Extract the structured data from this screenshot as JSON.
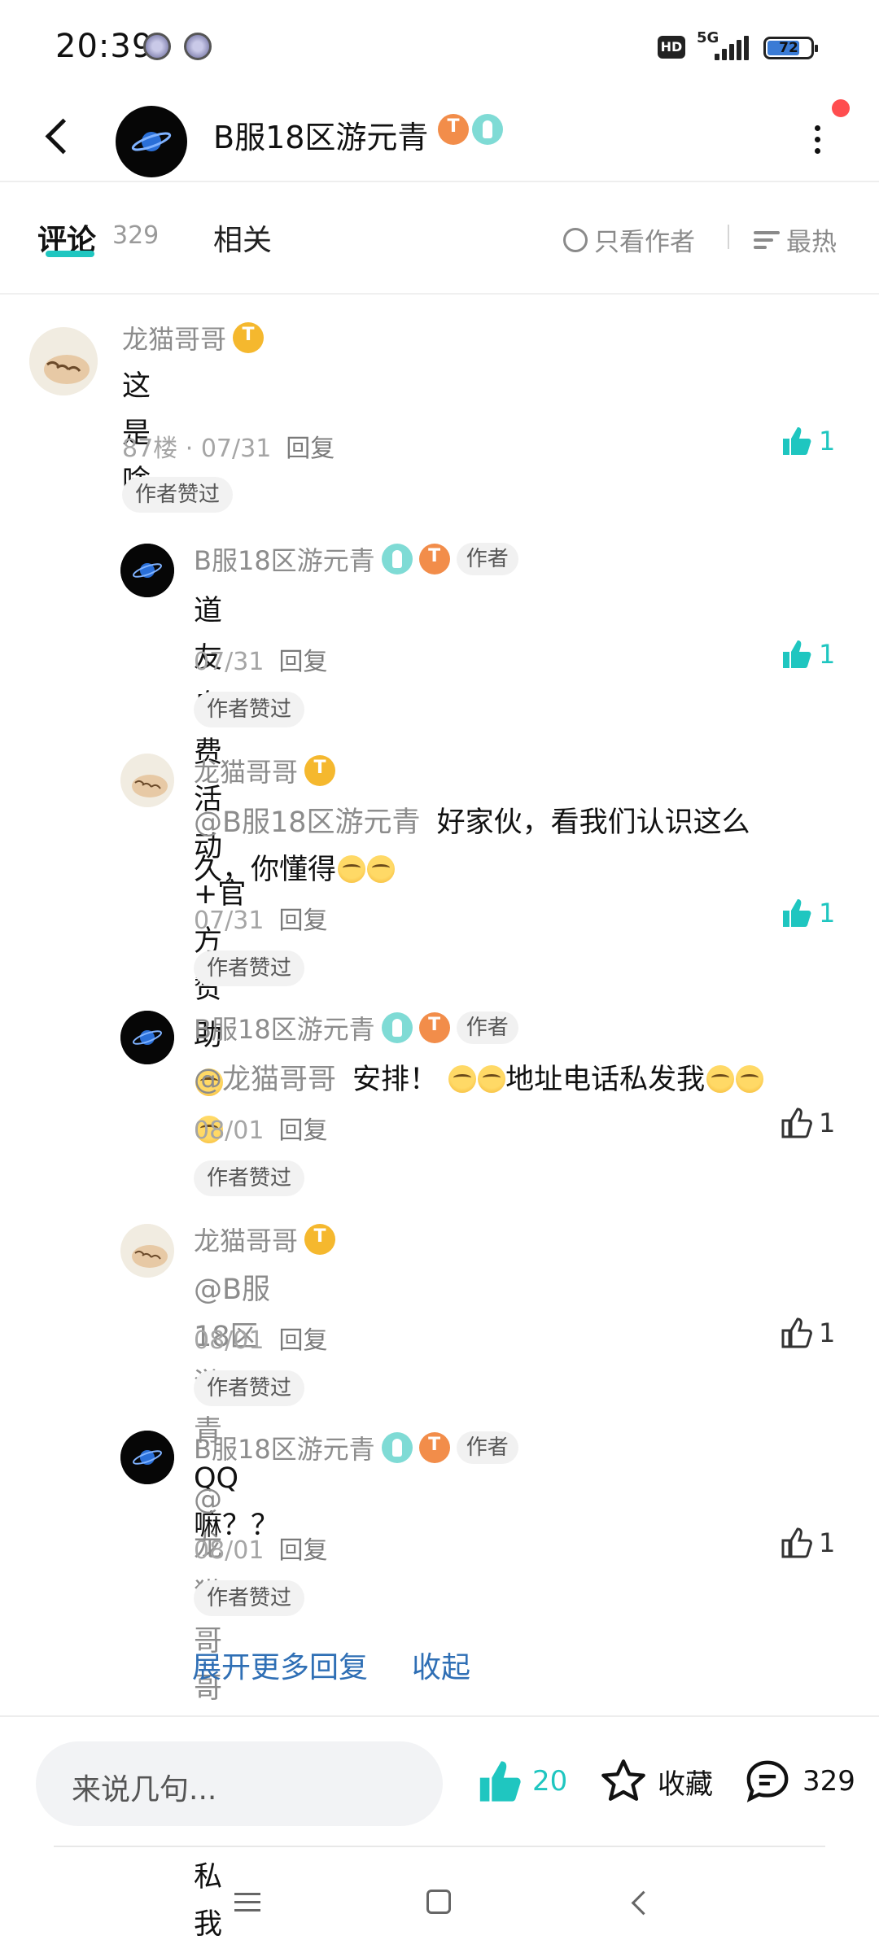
{
  "status_bar": {
    "time": "20:39",
    "network": "5G",
    "hd_label": "HD",
    "battery": "72"
  },
  "header": {
    "title": "B服18区游元青"
  },
  "tabs": {
    "comments_label": "评论",
    "comments_count": "329",
    "related_label": "相关",
    "author_only_label": "只看作者",
    "sort_label": "最热"
  },
  "comments": [
    {
      "user": "龙猫哥哥",
      "text": "这是啥",
      "floor": "87楼",
      "sep": "·",
      "date": "07/31",
      "reply": "回复",
      "likes": "1",
      "badge": "作者赞过"
    },
    {
      "user": "B服18区游元青",
      "author_tag": "作者",
      "text": "道友自费活动+官方赞助",
      "date": "07/31",
      "reply": "回复",
      "likes": "1",
      "badge": "作者赞过"
    },
    {
      "user": "龙猫哥哥",
      "mention": "@B服18区游元青",
      "text_line1": "好家伙，看我们认识这么",
      "text_line2": "久，你懂得",
      "date": "07/31",
      "reply": "回复",
      "likes": "1",
      "badge": "作者赞过"
    },
    {
      "user": "B服18区游元青",
      "author_tag": "作者",
      "mention": "@龙猫哥哥",
      "text_a": "安排！",
      "text_b": "地址电话私发我",
      "date": "08/01",
      "reply": "回复",
      "likes": "1",
      "badge": "作者赞过"
    },
    {
      "user": "龙猫哥哥",
      "mention": "@B服18区游元青",
      "text": "QQ嘛？？",
      "date": "08/01",
      "reply": "回复",
      "likes": "1",
      "badge": "作者赞过"
    },
    {
      "user": "B服18区游元青",
      "author_tag": "作者",
      "mention": "@龙猫哥哥",
      "text": "V，加群私我",
      "date": "08/01",
      "reply": "回复",
      "likes": "1",
      "badge": "作者赞过"
    }
  ],
  "replies_actions": {
    "expand": "展开更多回复",
    "collapse": "收起"
  },
  "bottom_bar": {
    "input_placeholder": "来说几句...",
    "like_count": "20",
    "favorite_label": "收藏",
    "comment_count": "329"
  },
  "colors": {
    "accent": "#1fc6c0",
    "link": "#2f6fb5",
    "muted": "#8c8c8c"
  }
}
